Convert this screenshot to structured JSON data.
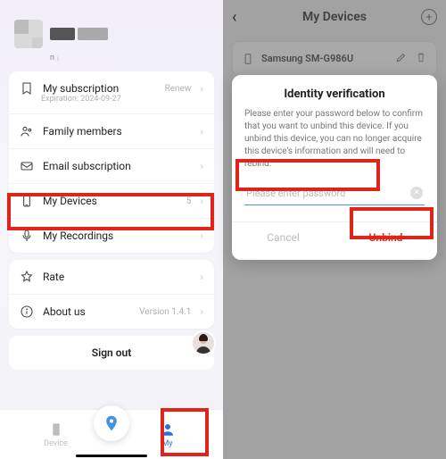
{
  "left": {
    "profile_sub_text": "n",
    "menu": {
      "subscription": {
        "label": "My subscription",
        "action": "Renew",
        "expiration": "Expiration: 2024-09-27"
      },
      "family": {
        "label": "Family members"
      },
      "email_sub": {
        "label": "Email subscription"
      },
      "devices": {
        "label": "My Devices",
        "count": "5"
      },
      "recordings": {
        "label": "My Recordings"
      },
      "rate": {
        "label": "Rate"
      },
      "about": {
        "label": "About us",
        "version": "Version 1.4.1"
      }
    },
    "signout": "Sign out",
    "tabs": {
      "device": "Device",
      "my": "My"
    }
  },
  "right": {
    "header_title": "My Devices",
    "device_name": "Samsung SM-G986U",
    "modal": {
      "title": "Identity verification",
      "body": "Please enter your password below to confirm that you want to unbind this device. If you unbind this device, you can no longer acquire this device's information and will need to rebind.",
      "placeholder": "Please enter password",
      "cancel": "Cancel",
      "unbind": "Unbind"
    }
  }
}
